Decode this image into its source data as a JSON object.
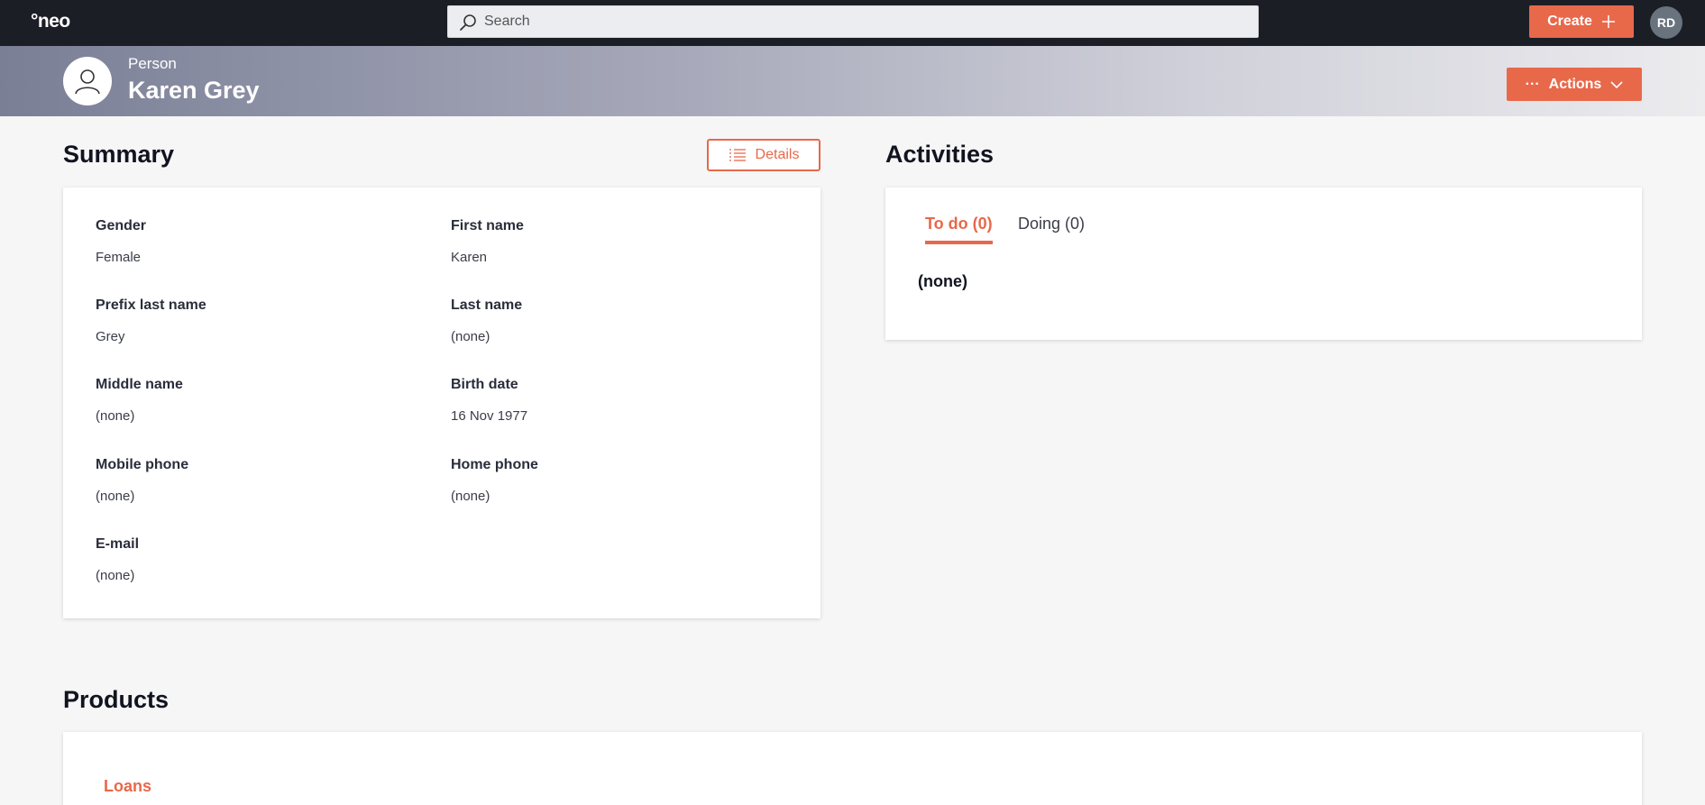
{
  "topbar": {
    "logo": "°neo",
    "search_placeholder": "Search",
    "create_label": "Create",
    "user_initials": "RD"
  },
  "header": {
    "entity_type": "Person",
    "entity_name": "Karen Grey",
    "actions_label": "Actions",
    "actions_dots": "···"
  },
  "summary": {
    "title": "Summary",
    "details_label": "Details",
    "fields": [
      {
        "label": "Gender",
        "value": "Female"
      },
      {
        "label": "First name",
        "value": "Karen"
      },
      {
        "label": "Prefix last name",
        "value": "Grey"
      },
      {
        "label": "Last name",
        "value": "(none)"
      },
      {
        "label": "Middle name",
        "value": "(none)"
      },
      {
        "label": "Birth date",
        "value": "16 Nov 1977"
      },
      {
        "label": "Mobile phone",
        "value": "(none)"
      },
      {
        "label": "Home phone",
        "value": "(none)"
      },
      {
        "label": "E-mail",
        "value": "(none)"
      }
    ]
  },
  "activities": {
    "title": "Activities",
    "tabs": [
      {
        "label": "To do (0)",
        "active": true
      },
      {
        "label": "Doing (0)",
        "active": false
      }
    ],
    "empty_text": "(none)"
  },
  "products": {
    "title": "Products",
    "link": "Loans"
  },
  "colors": {
    "accent": "#e8684a",
    "topbar": "#1c1e26",
    "avatar": "#68737d"
  }
}
